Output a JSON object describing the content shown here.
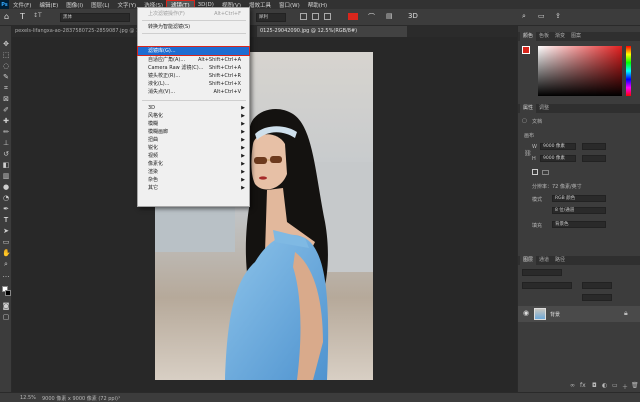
{
  "menubar": {
    "logo": "Ps",
    "items": [
      "文件(F)",
      "编辑(E)",
      "图像(I)",
      "图层(L)",
      "文字(Y)",
      "选择(S)",
      "滤镜(T)",
      "3D(D)",
      "视图(V)",
      "增效工具",
      "窗口(W)",
      "帮助(H)"
    ]
  },
  "options": {
    "font_family": "黑体",
    "font_style": "粗",
    "anti_alias": "犀利"
  },
  "tabs": {
    "left": "pexels-lifangxa-ao-2837580725-2859087.jpg @ 12...",
    "right": "0125-29042090.jpg @ 12.5%(RGB/8#)"
  },
  "filter_menu": {
    "items": [
      {
        "label": "上次滤镜操作(F)",
        "shortcut": "Alt+Ctrl+F",
        "disabled": true
      },
      {
        "label": "转换为智能滤镜(S)",
        "shortcut": ""
      },
      {
        "label": "滤镜库(G)...",
        "shortcut": "",
        "highlight": true
      },
      {
        "label": "自适应广角(A)...",
        "shortcut": "Alt+Shift+Ctrl+A"
      },
      {
        "label": "Camera Raw 滤镜(C)...",
        "shortcut": "Shift+Ctrl+A"
      },
      {
        "label": "镜头校正(R)...",
        "shortcut": "Shift+Ctrl+R"
      },
      {
        "label": "液化(L)...",
        "shortcut": "Shift+Ctrl+X"
      },
      {
        "label": "消失点(V)...",
        "shortcut": "Alt+Ctrl+V"
      },
      {
        "label": "3D",
        "submenu": true
      },
      {
        "label": "风格化",
        "submenu": true
      },
      {
        "label": "模糊",
        "submenu": true
      },
      {
        "label": "模糊画廊",
        "submenu": true
      },
      {
        "label": "扭曲",
        "submenu": true
      },
      {
        "label": "锐化",
        "submenu": true
      },
      {
        "label": "视频",
        "submenu": true
      },
      {
        "label": "像素化",
        "submenu": true
      },
      {
        "label": "渲染",
        "submenu": true
      },
      {
        "label": "杂色",
        "submenu": true
      },
      {
        "label": "其它",
        "submenu": true
      }
    ]
  },
  "color_panel": {
    "tabs": [
      "颜色",
      "色板",
      "渐变",
      "图案"
    ]
  },
  "properties_panel": {
    "tabs": [
      "属性",
      "调整"
    ],
    "doc_label": "文档",
    "section": "画布",
    "width_label": "W",
    "width": "9000 像素",
    "height_label": "H",
    "height": "9000 像素",
    "resolution": "分辨率：72 像素/英寸",
    "mode_label": "模式",
    "mode": "RGB 颜色",
    "depth": "8 位/通道",
    "fill_label": "填充",
    "fill": "背景色"
  },
  "layers_panel": {
    "tabs": [
      "图层",
      "通道",
      "路径"
    ],
    "layer_name": "背景"
  },
  "statusbar": {
    "zoom": "12.5%",
    "info": "9000 像素 x 9000 像素 (72 ppi)"
  },
  "colors": {
    "accent": "#1e6cd1",
    "red_outline": "#d9261c"
  }
}
